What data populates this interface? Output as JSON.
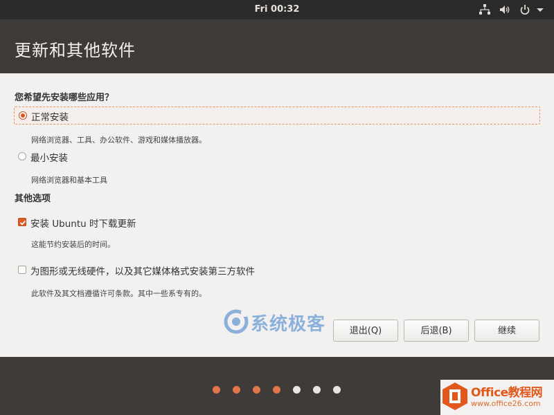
{
  "topbar": {
    "clock": "Fri 00:32",
    "icons": [
      "network-icon",
      "volume-icon",
      "power-icon",
      "menu-arrow-icon"
    ]
  },
  "header": {
    "title": "更新和其他软件"
  },
  "question": {
    "title": "您希望先安装哪些应用？",
    "options": [
      {
        "label": "正常安装",
        "description": "网络浏览器、工具、办公软件、游戏和媒体播放器。",
        "selected": true
      },
      {
        "label": "最小安装",
        "description": "网络浏览器和基本工具",
        "selected": false
      }
    ]
  },
  "other_options": {
    "title": "其他选项",
    "items": [
      {
        "label": "安装 Ubuntu 时下载更新",
        "description": "这能节约安装后的时间。",
        "checked": true
      },
      {
        "label": "为图形或无线硬件，以及其它媒体格式安装第三方软件",
        "description": "此软件及其文档遵循许可条款。其中一些系专有的。",
        "checked": false
      }
    ]
  },
  "watermark": {
    "text": "系统极客"
  },
  "buttons": {
    "quit": "退出(Q)",
    "back": "后退(B)",
    "continue": "继续"
  },
  "progress": {
    "total_steps": 7,
    "completed_steps": 4
  },
  "badge": {
    "title": "Office教程网",
    "url": "www.office26.com"
  },
  "colors": {
    "accent": "#e2571b",
    "header_bg": "#3d3a37",
    "content_bg": "#f2f1f0"
  }
}
